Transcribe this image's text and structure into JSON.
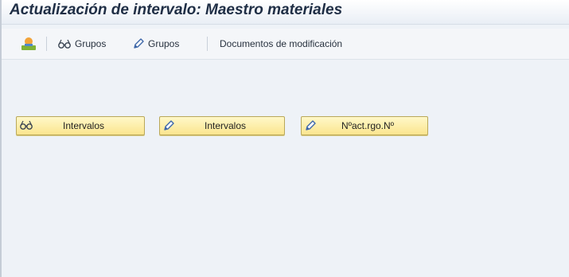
{
  "window": {
    "title": "Actualización de intervalo: Maestro materiales"
  },
  "toolbar": {
    "items": [
      {
        "label": "",
        "icon": "object-icon"
      },
      {
        "label": "Grupos",
        "icon": "glasses-icon"
      },
      {
        "label": "Grupos",
        "icon": "pencil-icon"
      },
      {
        "label": "Documentos de modificación",
        "icon": ""
      }
    ]
  },
  "main": {
    "buttons": [
      {
        "label": "Intervalos",
        "icon": "glasses-icon"
      },
      {
        "label": "Intervalos",
        "icon": "pencil-icon"
      },
      {
        "label": "Nºact.rgo.Nº",
        "icon": "pencil-icon"
      }
    ]
  },
  "colors": {
    "button_fill": "#fbe58e",
    "button_border": "#b9a85a",
    "title_text": "#1f2e45",
    "background": "#eef2f7"
  }
}
